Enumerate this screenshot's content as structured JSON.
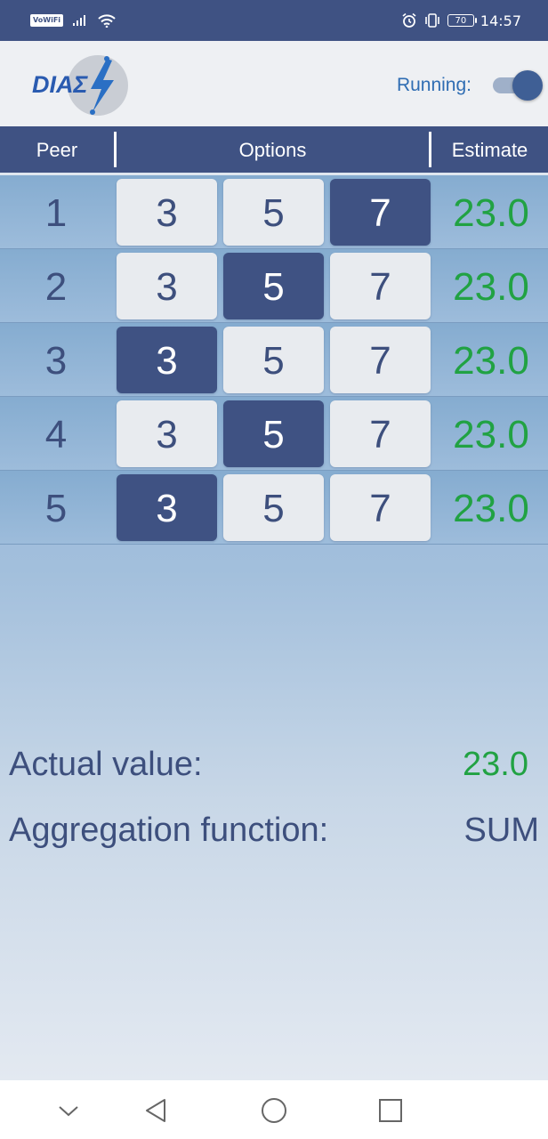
{
  "status_bar": {
    "network_badge": "VoWiFi",
    "battery_level": "70",
    "time": "14:57",
    "icons": [
      "signal-icon",
      "wifi-icon",
      "alarm-icon",
      "vibrate-icon",
      "battery-icon"
    ]
  },
  "app_bar": {
    "logo_text": "DIAΣ",
    "running_label": "Running:",
    "running_enabled": true
  },
  "table": {
    "headers": [
      "Peer",
      "Options",
      "Estimate"
    ],
    "rows": [
      {
        "peer": "1",
        "options": [
          "3",
          "5",
          "7"
        ],
        "selected_index": 2,
        "estimate": "23.0"
      },
      {
        "peer": "2",
        "options": [
          "3",
          "5",
          "7"
        ],
        "selected_index": 1,
        "estimate": "23.0"
      },
      {
        "peer": "3",
        "options": [
          "3",
          "5",
          "7"
        ],
        "selected_index": 0,
        "estimate": "23.0"
      },
      {
        "peer": "4",
        "options": [
          "3",
          "5",
          "7"
        ],
        "selected_index": 1,
        "estimate": "23.0"
      },
      {
        "peer": "5",
        "options": [
          "3",
          "5",
          "7"
        ],
        "selected_index": 0,
        "estimate": "23.0"
      }
    ]
  },
  "summary": {
    "actual_label": "Actual value:",
    "actual_value": "23.0",
    "aggregation_label": "Aggregation function:",
    "aggregation_value": "SUM"
  },
  "nav_bar": {
    "icons": [
      "collapse-icon",
      "back-icon",
      "home-icon",
      "recents-icon"
    ]
  },
  "colors": {
    "primary": "#3f5283",
    "estimate_green": "#21a243",
    "accent_blue": "#2f6db3"
  }
}
